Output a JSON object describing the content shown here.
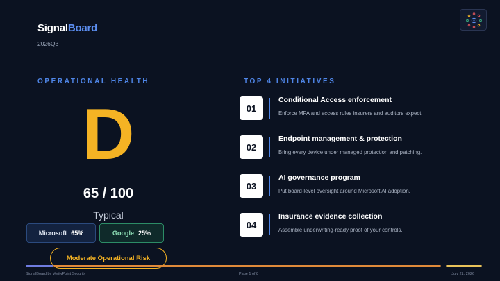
{
  "brand": {
    "part1": "Signal",
    "part2": "Board",
    "accent_color": "#5b8def"
  },
  "period": "2026Q3",
  "logo": {
    "icon": "network-nodes-icon"
  },
  "health": {
    "label": "OPERATIONAL HEALTH",
    "grade": "D",
    "score": "65 / 100",
    "rating": "Typical",
    "grade_color": "#f5b324",
    "microsoft": {
      "label": "Microsoft",
      "value": "65%"
    },
    "google": {
      "label": "Google",
      "value": "25%"
    },
    "risk": "Moderate Operational Risk"
  },
  "initiatives": {
    "label": "TOP 4 INITIATIVES",
    "items": [
      {
        "num": "01",
        "title": "Conditional Access enforcement",
        "desc": "Enforce MFA and access rules insurers and auditors expect."
      },
      {
        "num": "02",
        "title": "Endpoint management & protection",
        "desc": "Bring every device under managed protection and patching."
      },
      {
        "num": "03",
        "title": "AI governance program",
        "desc": "Put board-level oversight around Microsoft AI adoption."
      },
      {
        "num": "04",
        "title": "Insurance evidence collection",
        "desc": "Assemble underwriting-ready proof of your controls."
      }
    ]
  },
  "footer": {
    "left": "SignalBoard by VerityPoint Security",
    "page": "Page 1 of 8",
    "date": "July 21, 2026"
  }
}
